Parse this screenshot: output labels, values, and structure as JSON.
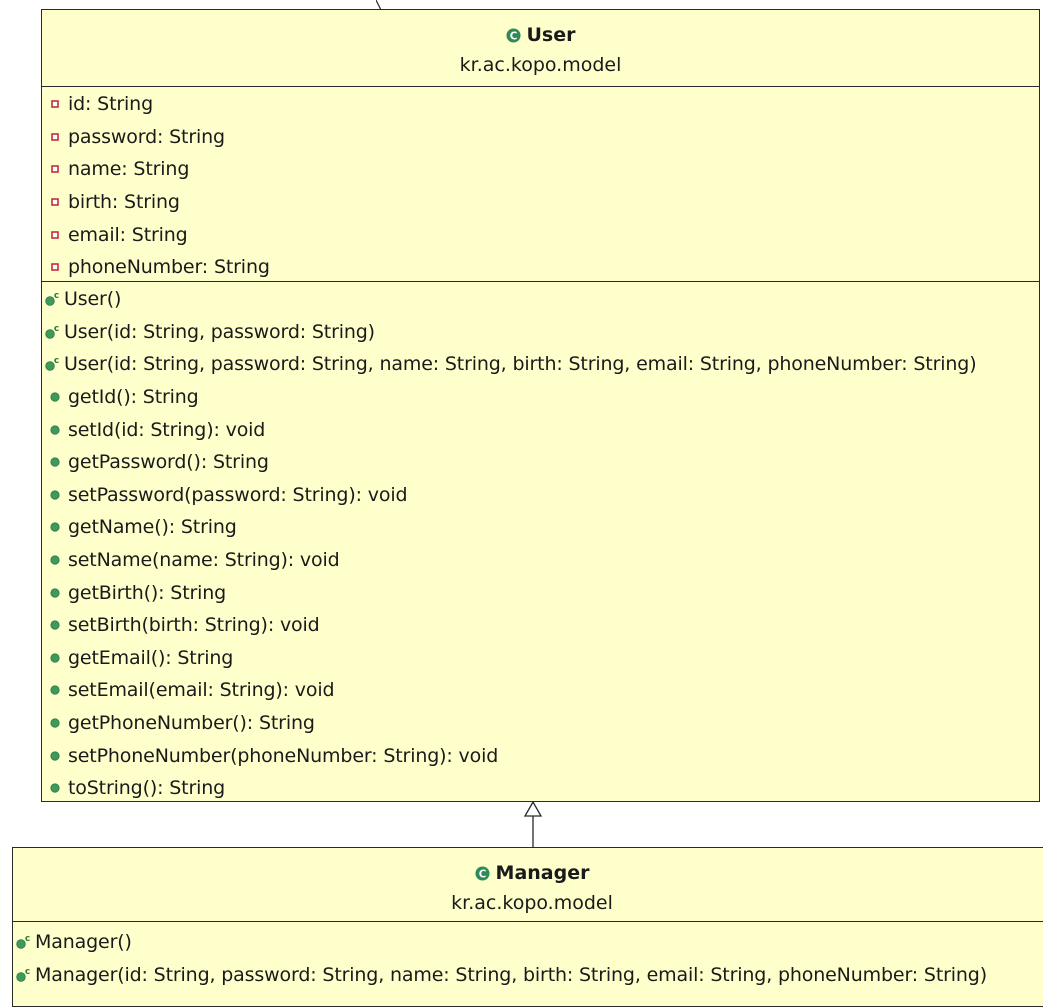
{
  "user_class": {
    "name": "User",
    "package": "kr.ac.kopo.model",
    "icon": "class-icon",
    "attributes": [
      {
        "text": "id: String",
        "visibility": "private"
      },
      {
        "text": "password: String",
        "visibility": "private"
      },
      {
        "text": "name: String",
        "visibility": "private"
      },
      {
        "text": "birth: String",
        "visibility": "private"
      },
      {
        "text": "email: String",
        "visibility": "private"
      },
      {
        "text": "phoneNumber: String",
        "visibility": "private"
      }
    ],
    "constructors": [
      {
        "text": "User()"
      },
      {
        "text": "User(id: String, password: String)"
      },
      {
        "text": "User(id: String, password: String, name: String, birth: String, email: String, phoneNumber: String)"
      }
    ],
    "methods": [
      {
        "text": "getId(): String"
      },
      {
        "text": "setId(id: String): void"
      },
      {
        "text": "getPassword(): String"
      },
      {
        "text": "setPassword(password: String): void"
      },
      {
        "text": "getName(): String"
      },
      {
        "text": "setName(name: String): void"
      },
      {
        "text": "getBirth(): String"
      },
      {
        "text": "setBirth(birth: String): void"
      },
      {
        "text": "getEmail(): String"
      },
      {
        "text": "setEmail(email: String): void"
      },
      {
        "text": "getPhoneNumber(): String"
      },
      {
        "text": "setPhoneNumber(phoneNumber: String): void"
      },
      {
        "text": "toString(): String"
      }
    ]
  },
  "manager_class": {
    "name": "Manager",
    "package": "kr.ac.kopo.model",
    "icon": "class-icon",
    "constructors": [
      {
        "text": "Manager()"
      },
      {
        "text": "Manager(id: String, password: String, name: String, birth: String, email: String, phoneNumber: String)"
      }
    ]
  },
  "colors": {
    "class_fill": "#ffffcc",
    "border": "#2a2a2a",
    "private_field": "#c0303a",
    "public_method": "#3f9a5a",
    "class_icon": "#2e8b57"
  }
}
